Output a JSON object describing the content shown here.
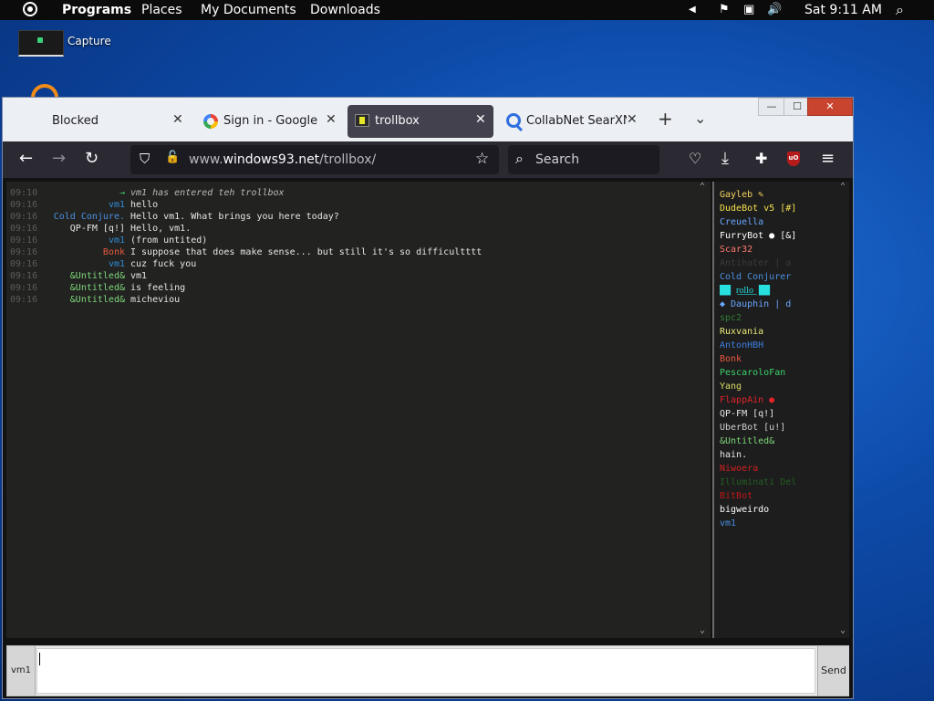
{
  "top_panel": {
    "programs": "Programs",
    "places": "Places",
    "documents": "My Documents",
    "downloads": "Downloads",
    "clock": "Sat 9:11 AM"
  },
  "desktop": {
    "capture_label": "Capture"
  },
  "browser": {
    "tabs": [
      {
        "label": "Blocked"
      },
      {
        "label": "Sign in - Google Acc"
      },
      {
        "label": "trollbox"
      },
      {
        "label": "CollabNet SearXNG"
      }
    ],
    "url_prefix": "www.",
    "url_host": "windows93.net",
    "url_path": "/trollbox/",
    "search_placeholder": "Search",
    "ublock_badge": "uO"
  },
  "trollbox": {
    "messages": [
      {
        "time": "09:10",
        "nick": "→",
        "nick_color": "#3bd16a",
        "text": "vm1 has entered teh trollbox",
        "system": true
      },
      {
        "time": "09:16",
        "nick": "vm1",
        "nick_color": "#2f8bd6",
        "text": "hello"
      },
      {
        "time": "09:16",
        "nick": "Cold Conjure.",
        "nick_color": "#4a8fe0",
        "text": "Hello vm1. What brings you here today?"
      },
      {
        "time": "09:16",
        "nick": "QP-FM [q!]",
        "nick_color": "#e6e6e6",
        "text": "Hello, vm1."
      },
      {
        "time": "09:16",
        "nick": "vm1",
        "nick_color": "#2f8bd6",
        "text": "(from untited)"
      },
      {
        "time": "09:16",
        "nick": "Bonk",
        "nick_color": "#e8583e",
        "text": "I suppose that does make sense... but still it's so difficultttt"
      },
      {
        "time": "09:16",
        "nick": "vm1",
        "nick_color": "#2f8bd6",
        "text": "cuz fuck you"
      },
      {
        "time": "09:16",
        "nick": "&Untitled&",
        "nick_color": "#7ed67a",
        "text": "vm1"
      },
      {
        "time": "09:16",
        "nick": "&Untitled&",
        "nick_color": "#7ed67a",
        "text": "is feeling"
      },
      {
        "time": "09:16",
        "nick": "&Untitled&",
        "nick_color": "#7ed67a",
        "text": "micheviou"
      }
    ],
    "users": [
      {
        "name": "Gayleb ✎",
        "color": "#f4d35e"
      },
      {
        "name": "DudeBot v5 [#]",
        "color": "#f4e04d"
      },
      {
        "name": "Creuella",
        "color": "#6aa7ff"
      },
      {
        "name": "FurryBot ● [&]",
        "color": "#ffffff"
      },
      {
        "name": "Scar32",
        "color": "#ff7a6e"
      },
      {
        "name": "Antihater | a",
        "color": "#3a3a3a"
      },
      {
        "name": "Cold Conjurer",
        "color": "#4a8fe0"
      },
      {
        "name": "██ r͟o͟l͟l͟o͟ ██",
        "color": "#27e0e0"
      },
      {
        "name": "◆ Dauphin | d",
        "color": "#6aa7ff"
      },
      {
        "name": "spc2",
        "color": "#2e7d32"
      },
      {
        "name": "Ruxvania",
        "color": "#e8e87a"
      },
      {
        "name": "AntonHBH",
        "color": "#3d7fe0"
      },
      {
        "name": "Bonk",
        "color": "#e8583e"
      },
      {
        "name": "PescaroloFan",
        "color": "#3bd16a"
      },
      {
        "name": "Yang",
        "color": "#dddd66"
      },
      {
        "name": "FlappAin ●",
        "color": "#e0242a"
      },
      {
        "name": "QP-FM [q!]",
        "color": "#e6e6e6"
      },
      {
        "name": "UberBot [u!]",
        "color": "#cfcfcf"
      },
      {
        "name": "&Untitled&",
        "color": "#7ed67a"
      },
      {
        "name": "hain.",
        "color": "#e6e6e6"
      },
      {
        "name": "Niwoera",
        "color": "#d02020"
      },
      {
        "name": "Illuminati Del",
        "color": "#235f23"
      },
      {
        "name": "BitBot",
        "color": "#c01818"
      },
      {
        "name": "bigweirdo",
        "color": "#ffffff"
      },
      {
        "name": "vm1",
        "color": "#4a8fe0"
      }
    ],
    "input_nick": "vm1",
    "send_label": "Send"
  }
}
